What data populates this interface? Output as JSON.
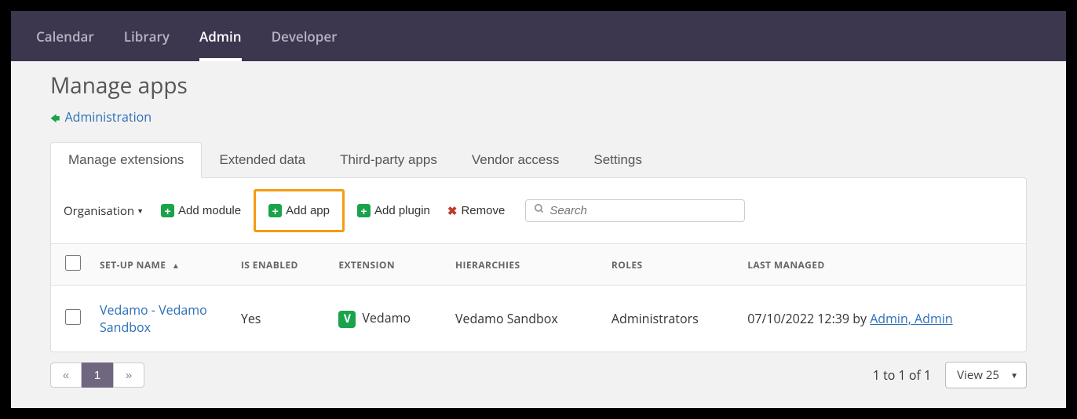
{
  "topnav": {
    "items": [
      "Calendar",
      "Library",
      "Admin",
      "Developer"
    ],
    "active_index": 2
  },
  "page_title": "Manage apps",
  "breadcrumb": {
    "label": "Administration"
  },
  "tabs": {
    "items": [
      "Manage extensions",
      "Extended data",
      "Third-party apps",
      "Vendor access",
      "Settings"
    ],
    "active_index": 0
  },
  "toolbar": {
    "organisation_label": "Organisation",
    "add_module": "Add module",
    "add_app": "Add app",
    "add_plugin": "Add plugin",
    "remove": "Remove",
    "search_placeholder": "Search"
  },
  "table": {
    "headers": {
      "setup_name": "SET-UP NAME",
      "is_enabled": "IS ENABLED",
      "extension": "EXTENSION",
      "hierarchies": "HIERARCHIES",
      "roles": "ROLES",
      "last_managed": "LAST MANAGED"
    },
    "rows": [
      {
        "setup_name": "Vedamo - Vedamo Sandbox",
        "is_enabled": "Yes",
        "extension_badge": "V",
        "extension": "Vedamo",
        "hierarchies": "Vedamo Sandbox",
        "roles": "Administrators",
        "last_managed_time": "07/10/2022 12:39",
        "last_managed_by_label": " by ",
        "last_managed_by": "Admin, Admin"
      }
    ]
  },
  "pagination": {
    "prev": "«",
    "current": "1",
    "next": "»",
    "range": "1 to 1 of 1",
    "view_label": "View 25"
  }
}
